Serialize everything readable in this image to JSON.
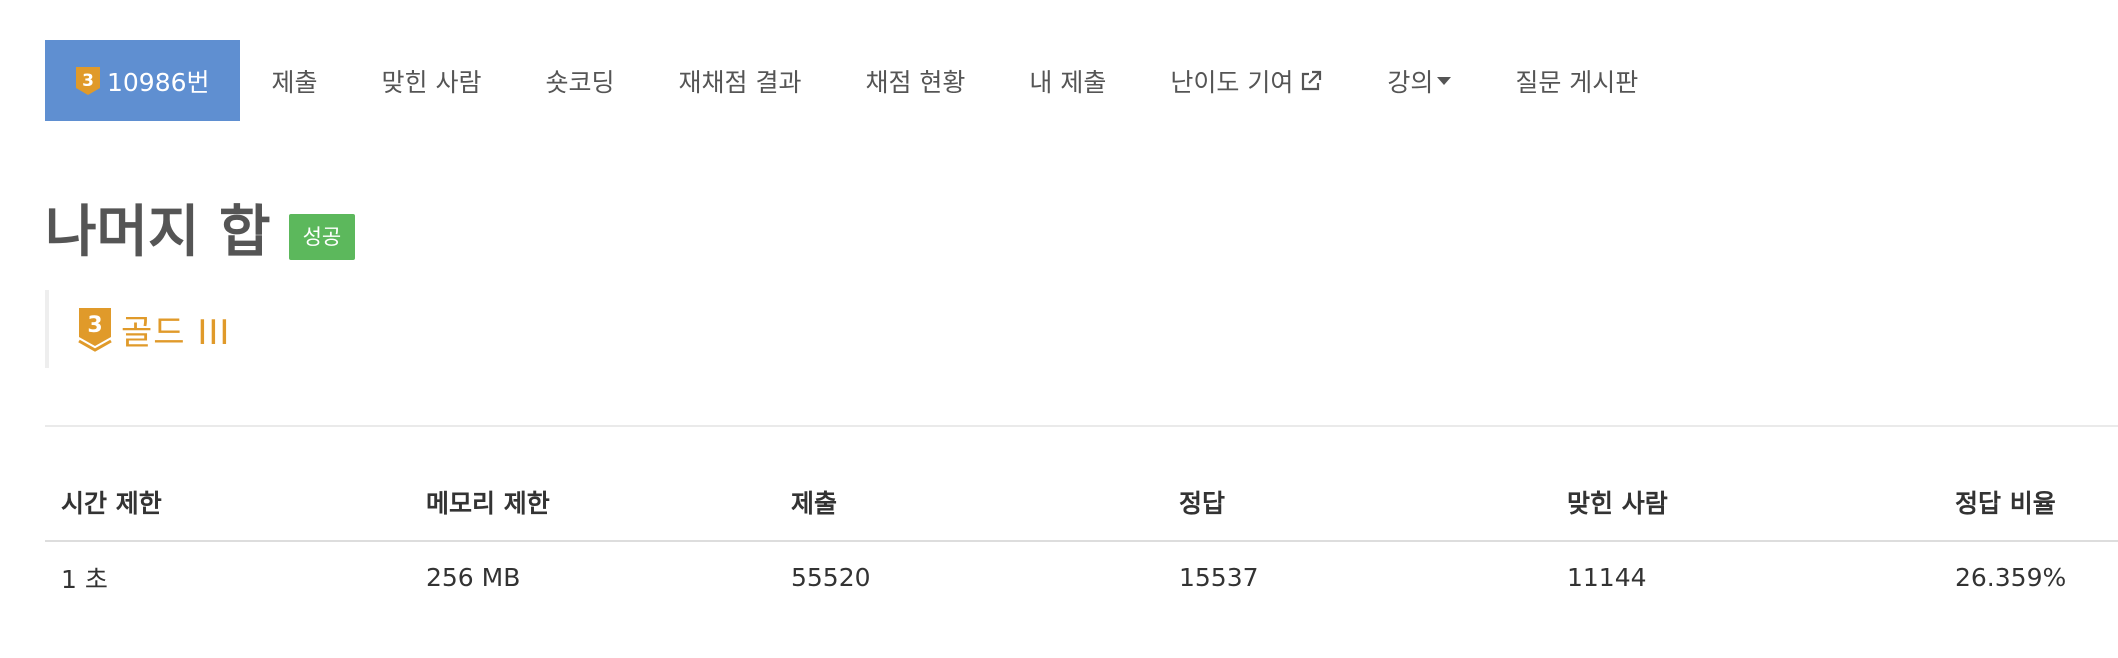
{
  "menu": {
    "active_problem": "10986번",
    "items": [
      {
        "label": "제출"
      },
      {
        "label": "맞힌 사람"
      },
      {
        "label": "숏코딩"
      },
      {
        "label": "재채점 결과"
      },
      {
        "label": "채점 현황"
      },
      {
        "label": "내 제출"
      },
      {
        "label": "난이도 기여"
      },
      {
        "label": "강의"
      },
      {
        "label": "질문 게시판"
      }
    ]
  },
  "problem": {
    "title": "나머지 합",
    "result_badge": "성공",
    "tier_label": "골드 III",
    "tier_number": "3",
    "tier_color": "#e09a2a"
  },
  "info": {
    "headers": [
      "시간 제한",
      "메모리 제한",
      "제출",
      "정답",
      "맞힌 사람",
      "정답 비율"
    ],
    "values": [
      "1 초",
      "256 MB",
      "55520",
      "15537",
      "11144",
      "26.359%"
    ]
  },
  "colors": {
    "accent": "#5f8fd1",
    "success": "#5cb85c",
    "gold": "#e09a2a"
  }
}
